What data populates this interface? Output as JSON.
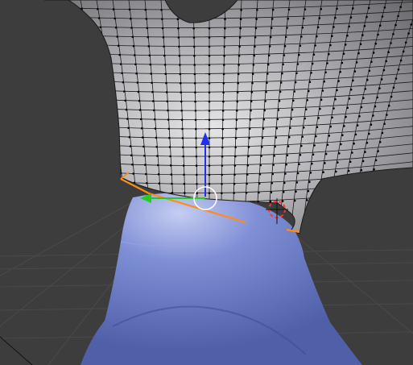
{
  "viewport": {
    "background_color": "#3d3d3d",
    "grid_line_color": "#4a4a4a"
  },
  "head_mesh": {
    "fill_color": "#a9a9ac",
    "wire_color": "#1a1a1a",
    "vertex_color": "#000000"
  },
  "shirt_mesh": {
    "fill_color": "#6f80c9",
    "highlight_color": "#c5cdf2"
  },
  "selection": {
    "selected_edge_color": "#ff8c1a"
  },
  "transform_gizmo": {
    "x_axis_color": "#22cc22",
    "z_axis_color": "#2230ee",
    "center_ring_color": "#ffffff"
  },
  "cursor_3d": {
    "ring_colors": [
      "#ff3333",
      "#ffffff"
    ]
  },
  "icons": [
    "x-axis-arrow-icon",
    "z-axis-arrow-icon",
    "center-ring-icon",
    "3d-cursor-icon"
  ]
}
